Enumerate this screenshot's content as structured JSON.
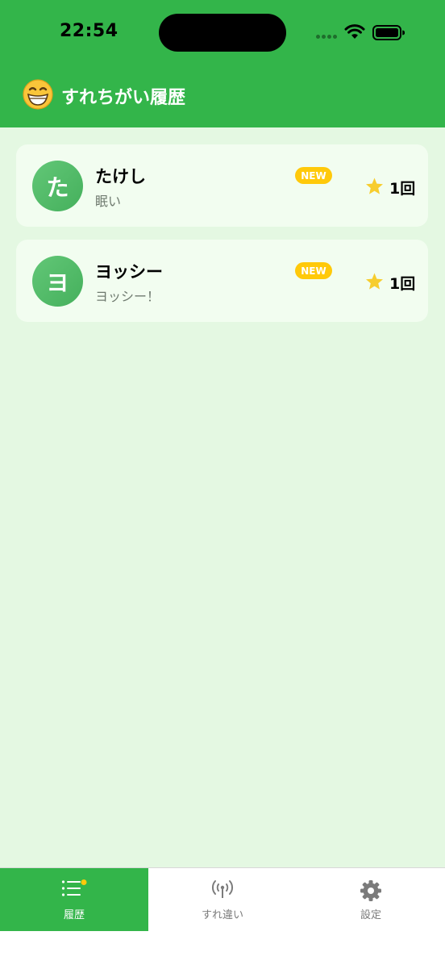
{
  "status_bar": {
    "time": "22:54"
  },
  "header": {
    "emoji": "grinning-face-icon",
    "title": "すれちがい履歴"
  },
  "entries": [
    {
      "initial": "た",
      "name": "たけし",
      "message": "眠い",
      "badge": "NEW",
      "count": "1回"
    },
    {
      "initial": "ヨ",
      "name": "ヨッシー",
      "message": "ヨッシー！",
      "badge": "NEW",
      "count": "1回"
    }
  ],
  "tabs": [
    {
      "label": "履歴",
      "icon": "list-icon",
      "active": true
    },
    {
      "label": "すれ違い",
      "icon": "antenna-icon",
      "active": false
    },
    {
      "label": "設定",
      "icon": "gear-icon",
      "active": false
    }
  ],
  "colors": {
    "primary": "#33b54a",
    "background": "#e4f8e2",
    "badge": "#ffc90a",
    "star": "#f7cd2e"
  }
}
